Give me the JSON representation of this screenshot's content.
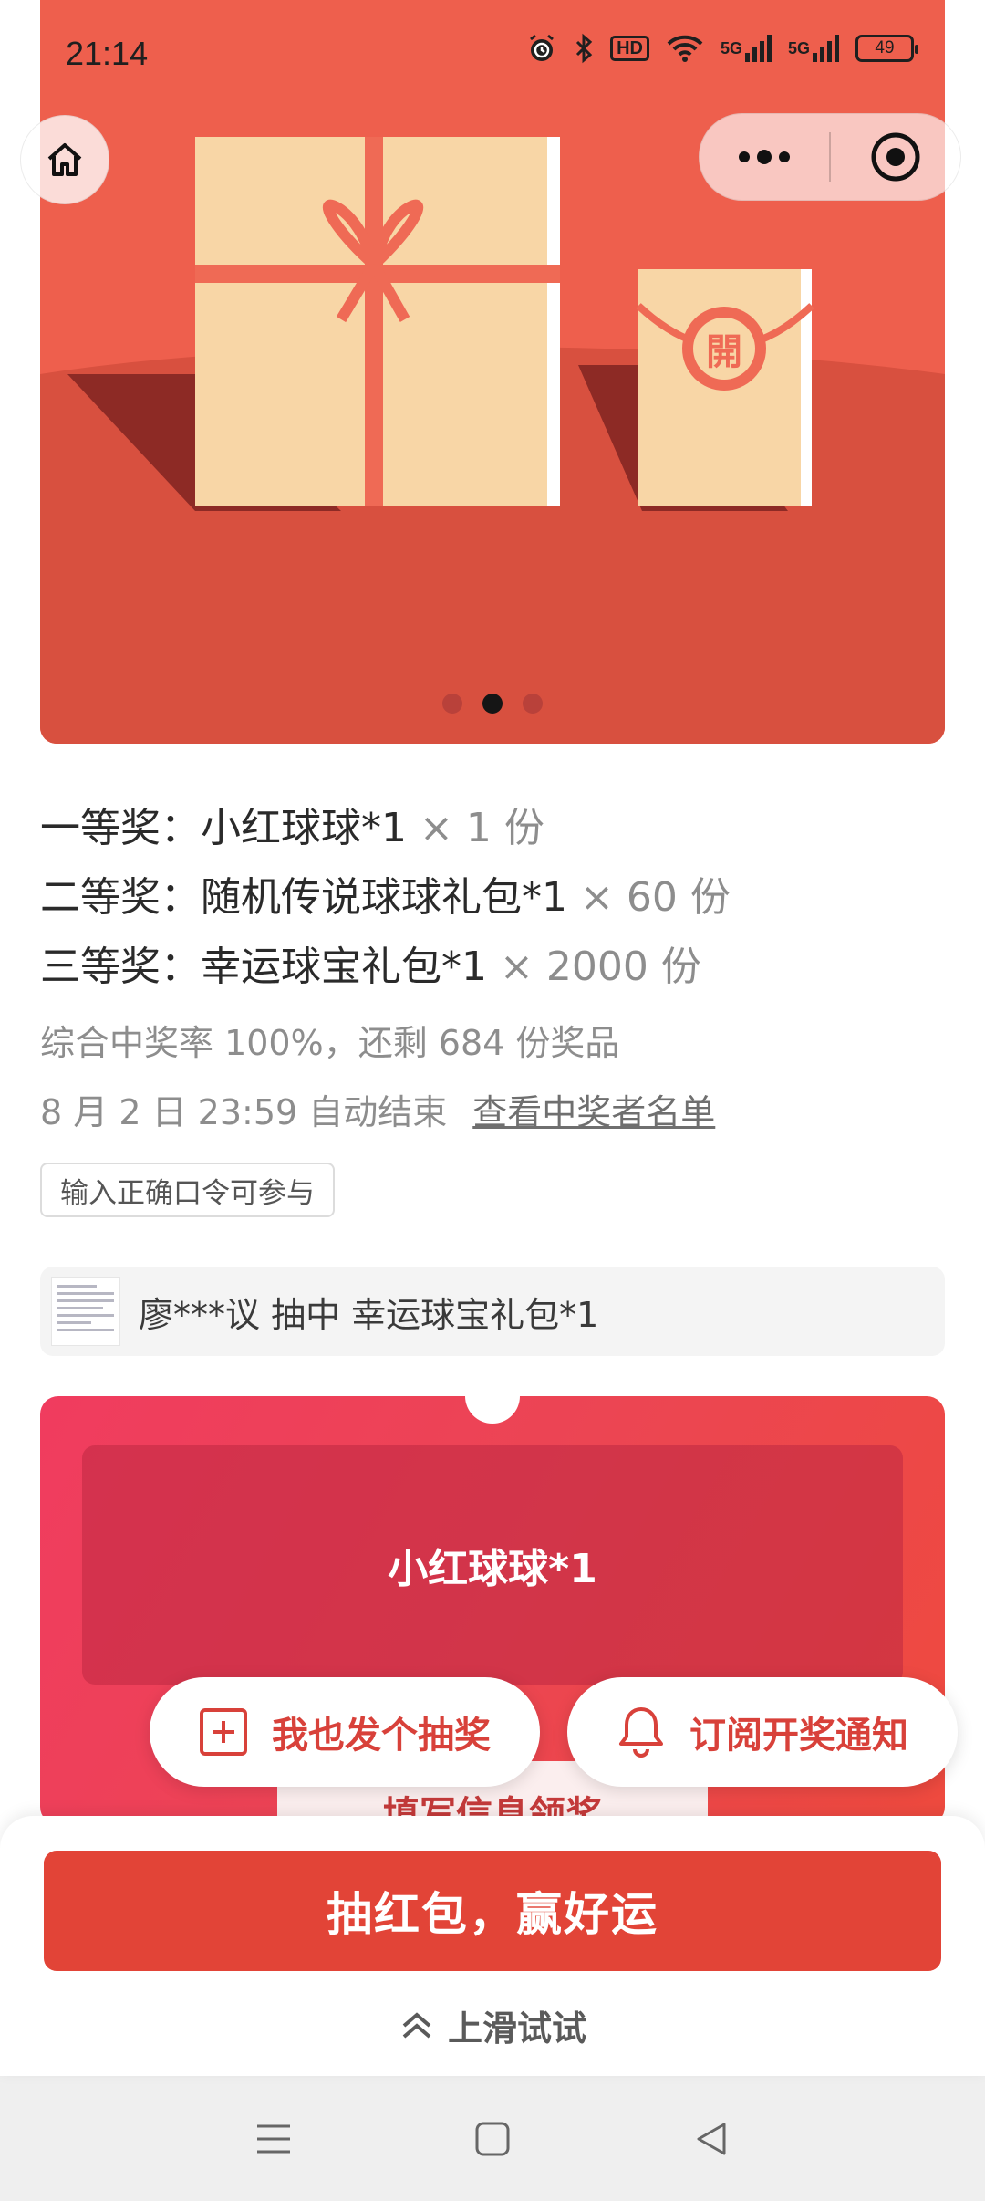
{
  "status_bar": {
    "time": "21:14",
    "hd_label": "HD",
    "net1": "5G",
    "net2": "5G",
    "battery": "49"
  },
  "banner": {
    "seal_text": "開",
    "carousel_total": 3,
    "carousel_active": 2
  },
  "prizes": [
    {
      "level": "一等奖：",
      "name": "小红球球*1",
      "count": " × 1 份"
    },
    {
      "level": "二等奖：",
      "name": "随机传说球球礼包*1",
      "count": " × 60 份"
    },
    {
      "level": "三等奖：",
      "name": "幸运球宝礼包*1",
      "count": " × 2000 份"
    }
  ],
  "stats": {
    "rate_text": "综合中奖率 100%，还剩 684 份奖品",
    "end_text": "8 月 2 日 23:59 自动结束",
    "winner_link": "查看中奖者名单"
  },
  "code_tag": "输入正确口令可参与",
  "ticker": {
    "text": "廖***议 抽中 幸运球宝礼包*1"
  },
  "card": {
    "prize_name": "小红球球*1",
    "claim_button": "填写信息领奖"
  },
  "floating": {
    "launch_label": "我也发个抽奖",
    "subscribe_label": "订阅开奖通知"
  },
  "bottom": {
    "cta_label": "抽红包，赢好运",
    "swipe_hint": "上滑试试"
  },
  "colors": {
    "accent": "#e24437",
    "banner_bg": "#ee5a4a",
    "gift": "#f8d6a6",
    "ribbon": "#ef6a55"
  }
}
